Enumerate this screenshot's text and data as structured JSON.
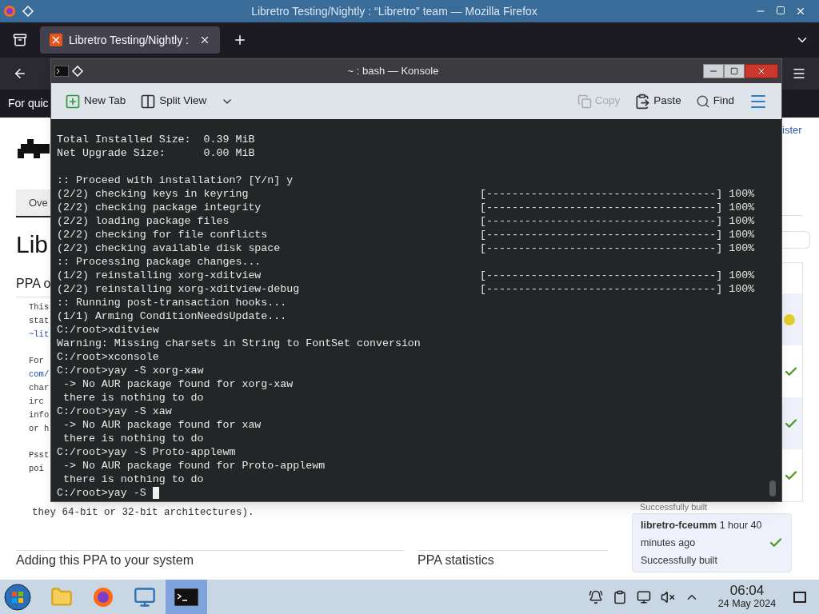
{
  "firefox": {
    "title": "Libretro Testing/Nightly : “Libretro” team — Mozilla Firefox",
    "tabs": [
      {
        "label": "Libretro Testing/Nightly :",
        "selected": true
      }
    ],
    "notice": "For quic"
  },
  "page": {
    "nav_tab": {
      "label": "Ove",
      "selected": true
    },
    "heading": "Lib",
    "section_title": "PPA o",
    "fragments": [
      {
        "text": "This",
        "kind": "text",
        "gap": false
      },
      {
        "text": "stat",
        "kind": "text",
        "gap": false
      },
      {
        "text": "~lit",
        "kind": "link",
        "gap": false
      },
      {
        "text": "For",
        "kind": "text",
        "gap": true
      },
      {
        "text": "com/",
        "kind": "link",
        "gap": false
      },
      {
        "text": "char",
        "kind": "text",
        "gap": false
      },
      {
        "text": "irc",
        "kind": "text",
        "gap": false
      },
      {
        "text": "info",
        "kind": "text",
        "gap": false
      },
      {
        "text": "or h",
        "kind": "text",
        "gap": false
      },
      {
        "text": "Psst",
        "kind": "text",
        "gap": true
      },
      {
        "text": "poi",
        "kind": "text",
        "gap": false
      }
    ],
    "continuation": "they 64-bit or 32-bit architectures).",
    "register_link": "ister",
    "build_statuses": [
      {
        "kind": "pending"
      },
      {
        "kind": "built"
      },
      {
        "kind": "built"
      },
      {
        "kind": "built"
      }
    ],
    "partial_status": "Successfully built",
    "last_build": {
      "summary": "**libretro-fceumm** 1 hour 40 minutes ago",
      "status_text": "Successfully built",
      "kind": "built"
    },
    "bottom_headings": [
      "Adding this PPA to your system",
      "PPA statistics"
    ]
  },
  "konsole": {
    "title": "~ : bash — Konsole",
    "toolbar": [
      {
        "label": "New Tab",
        "kind": "new-tab",
        "disabled": false
      },
      {
        "label": "Split View",
        "kind": "split-view",
        "disabled": false
      },
      {
        "label": "Copy",
        "kind": "copy",
        "disabled": true
      },
      {
        "label": "Paste",
        "kind": "paste",
        "disabled": false
      },
      {
        "label": "Find",
        "kind": "find",
        "disabled": false
      }
    ],
    "lines": [
      {
        "kind": "text",
        "text": "Total Installed Size:  0.39 MiB"
      },
      {
        "kind": "text",
        "text": "Net Upgrade Size:      0.00 MiB"
      },
      {
        "kind": "blank"
      },
      {
        "kind": "text",
        "text": ":: Proceed with installation? [Y/n] y"
      },
      {
        "kind": "text",
        "text": "(2/2) checking keys in keyring",
        "progress": "[------------------------------------] 100%"
      },
      {
        "kind": "text",
        "text": "(2/2) checking package integrity",
        "progress": "[------------------------------------] 100%"
      },
      {
        "kind": "text",
        "text": "(2/2) loading package files",
        "progress": "[------------------------------------] 100%"
      },
      {
        "kind": "text",
        "text": "(2/2) checking for file conflicts",
        "progress": "[------------------------------------] 100%"
      },
      {
        "kind": "text",
        "text": "(2/2) checking available disk space",
        "progress": "[------------------------------------] 100%"
      },
      {
        "kind": "text",
        "text": ":: Processing package changes..."
      },
      {
        "kind": "text",
        "text": "(1/2) reinstalling xorg-xditview",
        "progress": "[------------------------------------] 100%"
      },
      {
        "kind": "text",
        "text": "(2/2) reinstalling xorg-xditview-debug",
        "progress": "[------------------------------------] 100%"
      },
      {
        "kind": "text",
        "text": ":: Running post-transaction hooks..."
      },
      {
        "kind": "text",
        "text": "(1/1) Arming ConditionNeedsUpdate..."
      },
      {
        "kind": "text",
        "text": "C:/root>xditview"
      },
      {
        "kind": "text",
        "text": "Warning: Missing charsets in String to FontSet conversion"
      },
      {
        "kind": "text",
        "text": "C:/root>xconsole"
      },
      {
        "kind": "text",
        "text": "C:/root>yay -S xorg-xaw"
      },
      {
        "kind": "text",
        "text": " -> No AUR package found for xorg-xaw"
      },
      {
        "kind": "text",
        "text": " there is nothing to do"
      },
      {
        "kind": "text",
        "text": "C:/root>yay -S xaw"
      },
      {
        "kind": "text",
        "text": " -> No AUR package found for xaw"
      },
      {
        "kind": "text",
        "text": " there is nothing to do"
      },
      {
        "kind": "text",
        "text": "C:/root>yay -S Proto-applewm"
      },
      {
        "kind": "text",
        "text": " -> No AUR package found for Proto-applewm"
      },
      {
        "kind": "text",
        "text": " there is nothing to do"
      },
      {
        "kind": "text",
        "text": "C:/root>yay -S"
      }
    ],
    "cursor_visible": true
  },
  "taskbar": {
    "apps": [
      {
        "kind": "files",
        "selected": false
      },
      {
        "kind": "browser",
        "selected": false
      },
      {
        "kind": "settings",
        "selected": false
      },
      {
        "kind": "terminal",
        "selected": true
      }
    ],
    "time": "06:04",
    "date": "24 May 2024"
  }
}
